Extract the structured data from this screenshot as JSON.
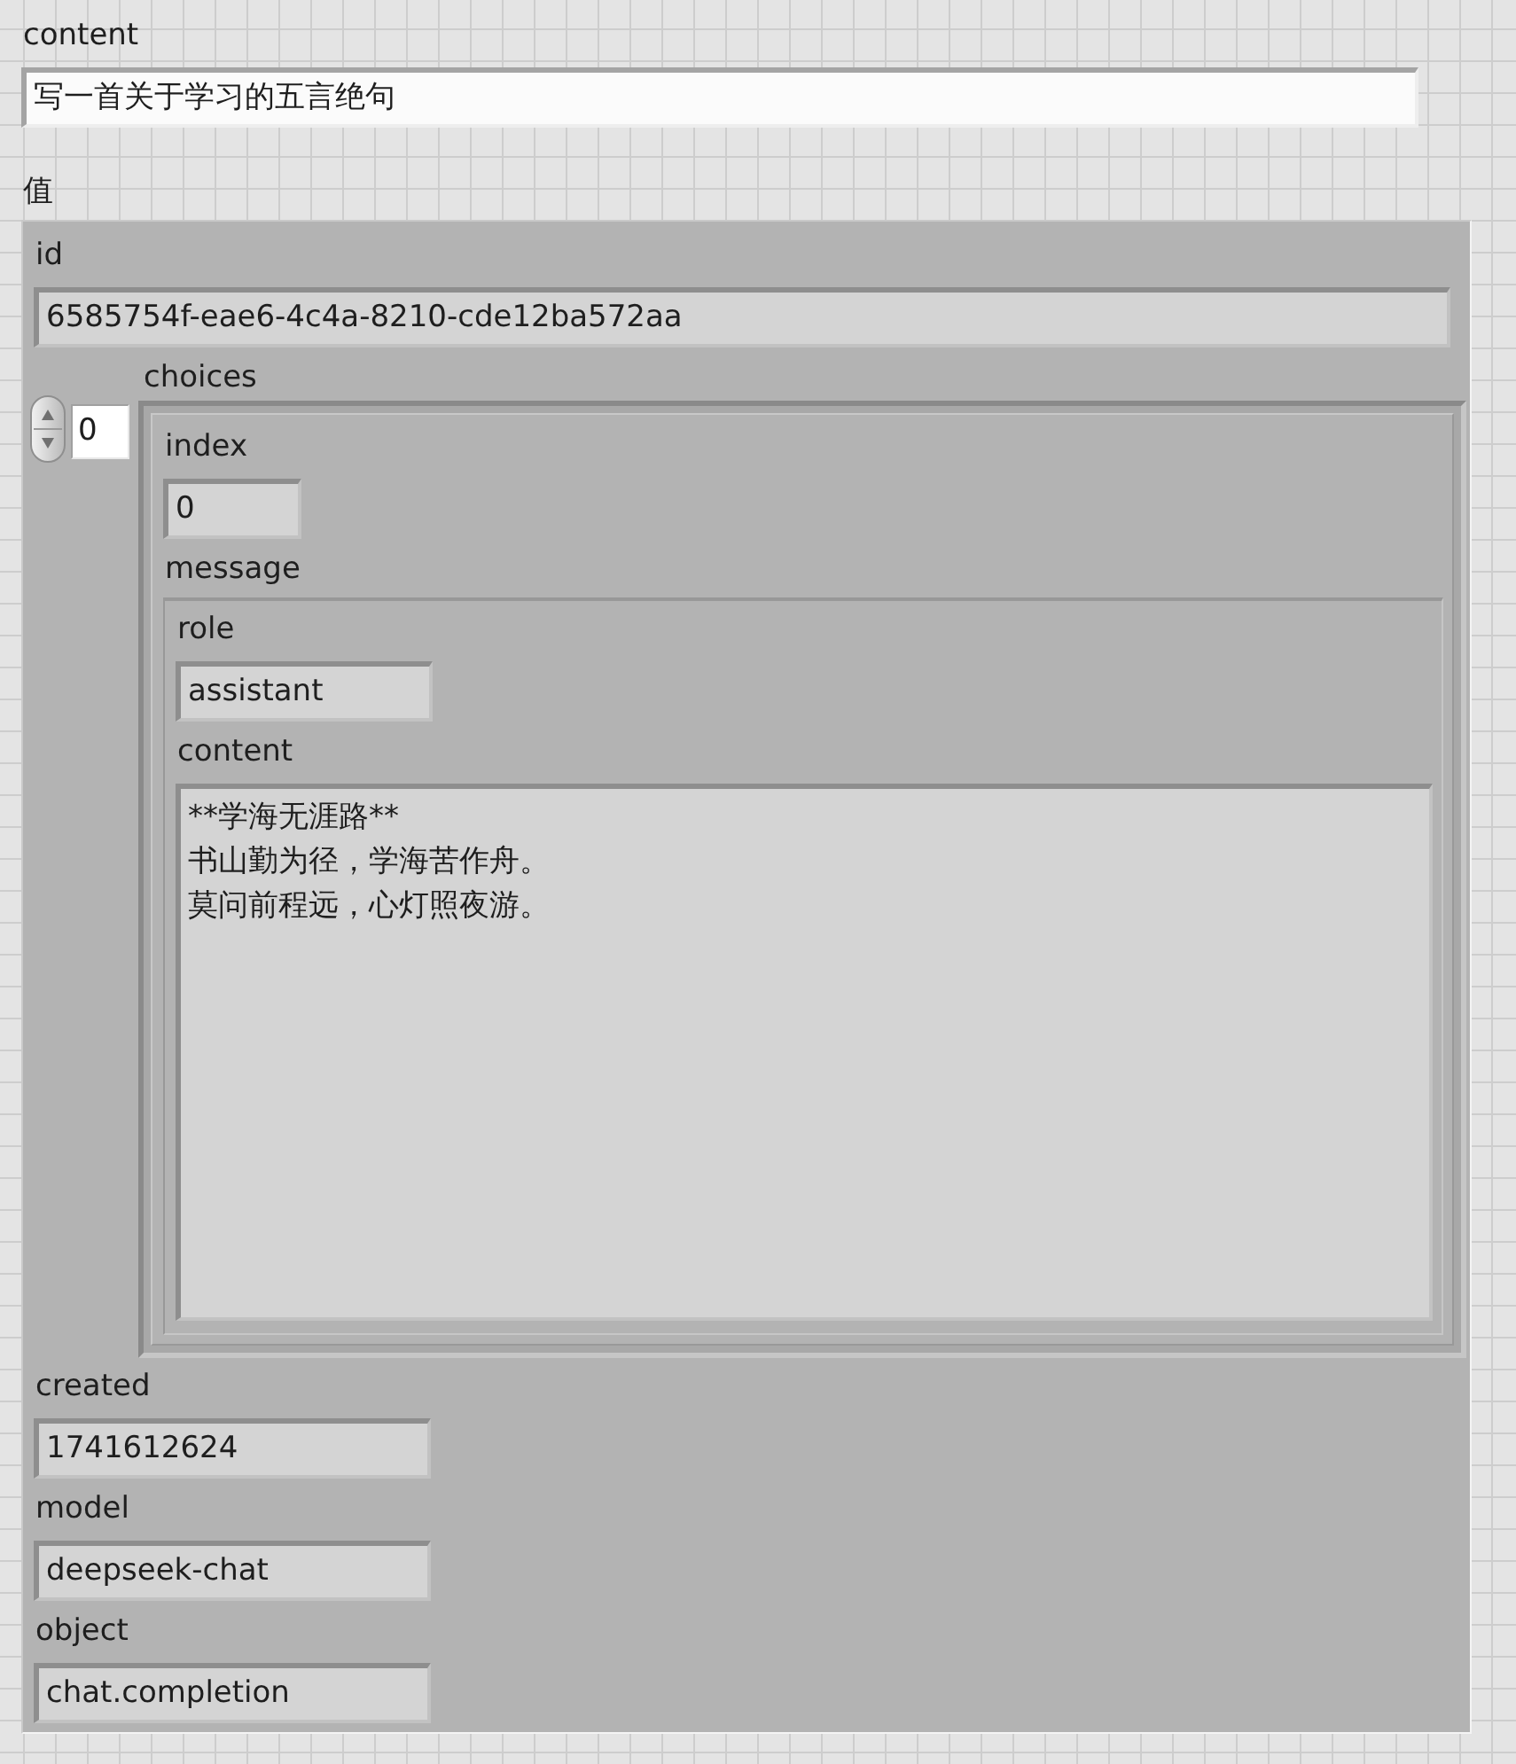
{
  "controls": [
    {
      "kind": "string",
      "label": "content",
      "value": "写一首关于学习的五言绝句"
    },
    {
      "kind": "cluster",
      "label": "值",
      "items": [
        {
          "kind": "string",
          "label": "id",
          "value": "6585754f-eae6-4c4a-8210-cde12ba572aa"
        },
        {
          "kind": "array",
          "label": "choices",
          "index": "0",
          "element": {
            "kind": "cluster",
            "items": [
              {
                "kind": "numeric",
                "label": "index",
                "value": "0"
              },
              {
                "kind": "cluster",
                "label": "message",
                "items": [
                  {
                    "kind": "string",
                    "label": "role",
                    "value": "assistant"
                  },
                  {
                    "kind": "text",
                    "label": "content",
                    "lines": [
                      "**学海无涯路**",
                      "书山勤为径，学海苦作舟。",
                      "莫问前程远，心灯照夜游。"
                    ]
                  }
                ]
              }
            ]
          }
        },
        {
          "kind": "string",
          "label": "created",
          "value": "1741612624"
        },
        {
          "kind": "string",
          "label": "model",
          "value": "deepseek-chat"
        },
        {
          "kind": "string",
          "label": "object",
          "value": "chat.completion"
        }
      ]
    }
  ]
}
